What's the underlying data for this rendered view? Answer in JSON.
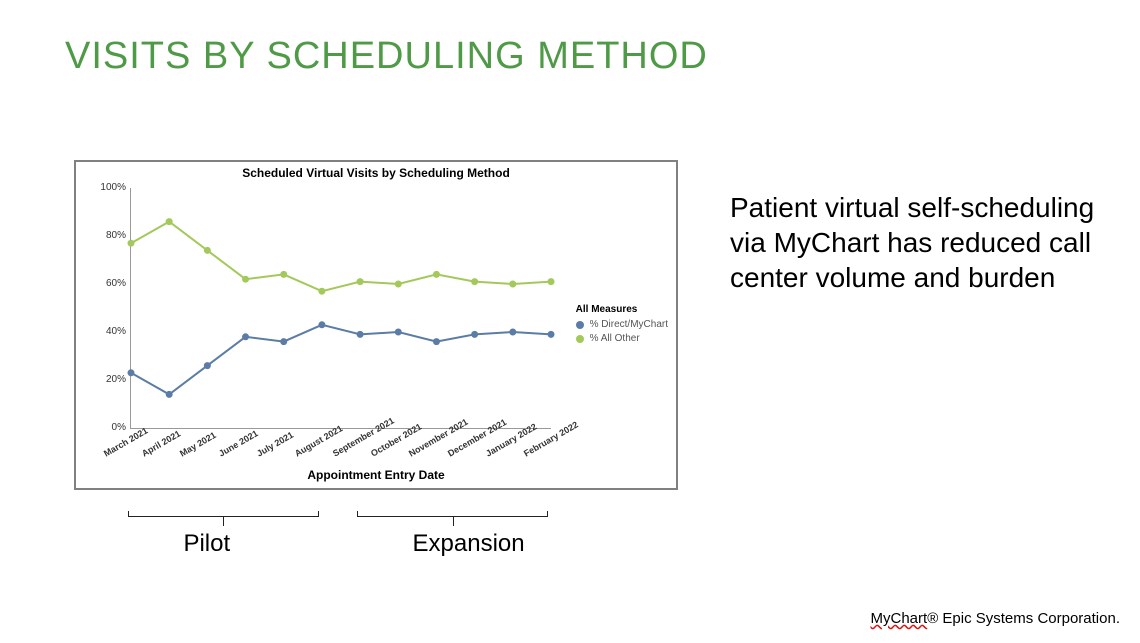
{
  "title": "VISITS BY SCHEDULING METHOD",
  "body_text": "Patient virtual self-scheduling via MyChart has reduced call center volume and burden",
  "footnote_brand": "MyChart",
  "footnote_reg": "®",
  "footnote_rest": " Epic Systems Corporation.",
  "chart_data": {
    "type": "line",
    "title": "Scheduled Virtual Visits by Scheduling Method",
    "xlabel": "Appointment Entry Date",
    "ylabel": "",
    "ylim": [
      0,
      100
    ],
    "yticks": [
      "0%",
      "20%",
      "40%",
      "60%",
      "80%",
      "100%"
    ],
    "categories": [
      "March 2021",
      "April 2021",
      "May 2021",
      "June 2021",
      "July 2021",
      "August 2021",
      "September 2021",
      "October 2021",
      "November 2021",
      "December 2021",
      "January 2022",
      "February 2022"
    ],
    "legend_title": "All Measures",
    "series": [
      {
        "name": "% Direct/MyChart",
        "color": "#5b7ca6",
        "values": [
          23,
          14,
          26,
          38,
          36,
          43,
          39,
          40,
          36,
          39,
          40,
          39
        ]
      },
      {
        "name": "% All Other",
        "color": "#a4c95b",
        "values": [
          77,
          86,
          74,
          62,
          64,
          57,
          61,
          60,
          64,
          61,
          60,
          61
        ]
      }
    ],
    "phases": [
      {
        "label": "Pilot",
        "from_index": 0,
        "to_index": 5
      },
      {
        "label": "Expansion",
        "from_index": 6,
        "to_index": 11
      }
    ]
  },
  "colors": {
    "title": "#4f9a46",
    "series1": "#5b7ca6",
    "series2": "#a4c95b"
  }
}
